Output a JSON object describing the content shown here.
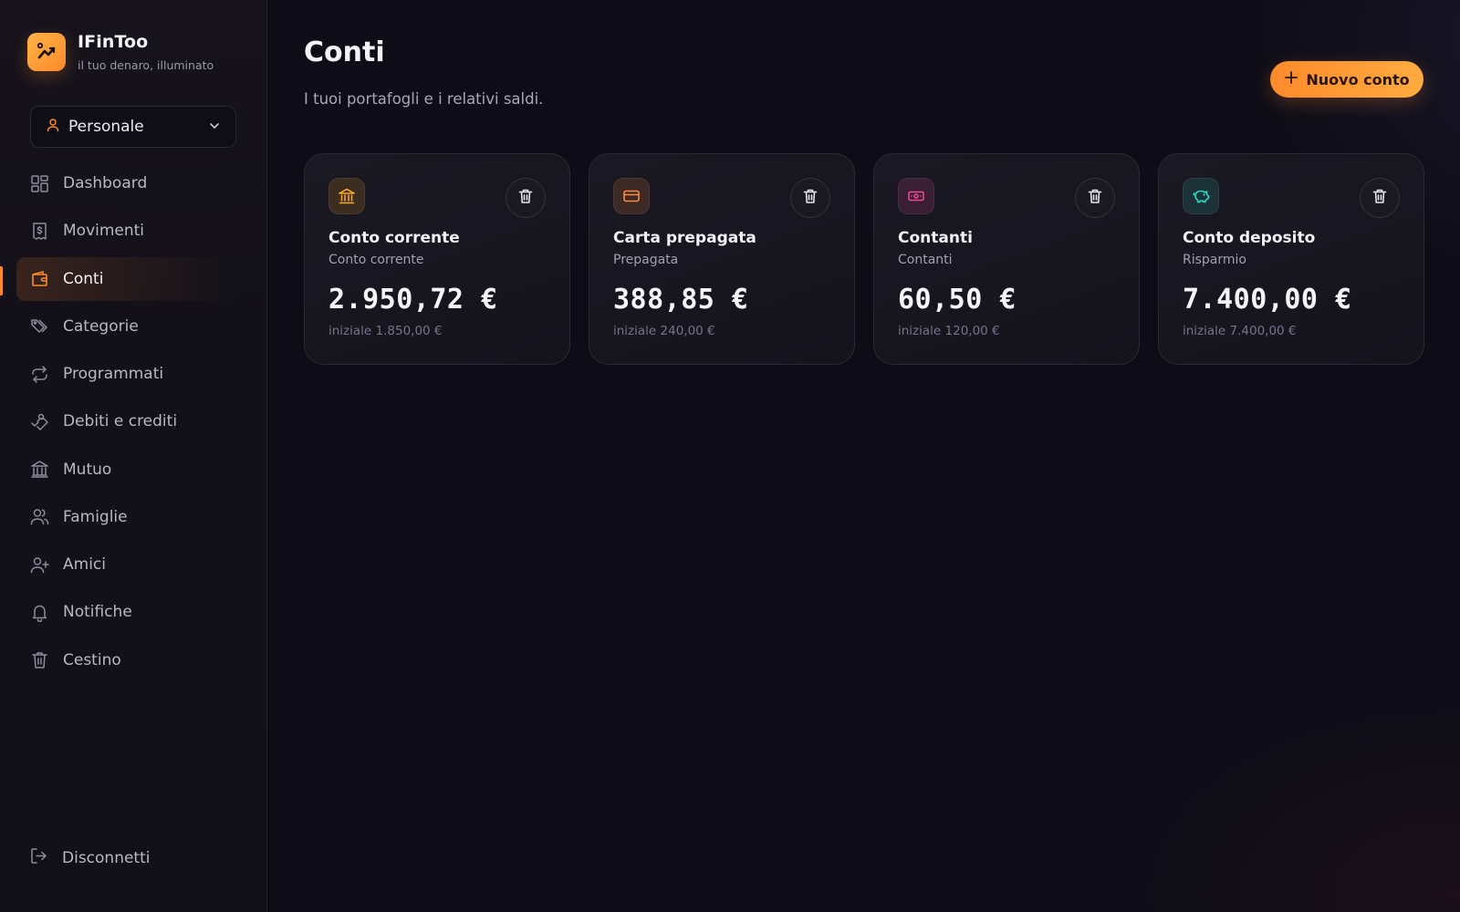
{
  "brand": {
    "name": "IFinToo",
    "tagline": "il tuo denaro, illuminato"
  },
  "profile": {
    "label": "Personale"
  },
  "nav": {
    "items": [
      {
        "label": "Dashboard",
        "icon": "dashboard-icon"
      },
      {
        "label": "Movimenti",
        "icon": "receipt-icon"
      },
      {
        "label": "Conti",
        "icon": "wallet-icon",
        "active": true
      },
      {
        "label": "Categorie",
        "icon": "tags-icon"
      },
      {
        "label": "Programmati",
        "icon": "repeat-icon"
      },
      {
        "label": "Debiti e crediti",
        "icon": "handshake-icon"
      },
      {
        "label": "Mutuo",
        "icon": "bank-icon"
      },
      {
        "label": "Famiglie",
        "icon": "users-icon"
      },
      {
        "label": "Amici",
        "icon": "user-plus-icon"
      },
      {
        "label": "Notifiche",
        "icon": "bell-icon"
      },
      {
        "label": "Cestino",
        "icon": "trash-icon"
      }
    ],
    "logout": "Disconnetti"
  },
  "main": {
    "title": "Conti",
    "subtitle": "I tuoi portafogli e i relativi saldi.",
    "new_button": "Nuovo conto"
  },
  "accounts": [
    {
      "name": "Conto corrente",
      "type": "Conto corrente",
      "balance": "2.950,72 €",
      "initial": "iniziale 1.850,00 €",
      "icon": "bank-icon",
      "color": "#f5a623"
    },
    {
      "name": "Carta prepagata",
      "type": "Prepagata",
      "balance": "388,85 €",
      "initial": "iniziale 240,00 €",
      "icon": "credit-card-icon",
      "color": "#ff8a3d"
    },
    {
      "name": "Contanti",
      "type": "Contanti",
      "balance": "60,50 €",
      "initial": "iniziale 120,00 €",
      "icon": "banknote-icon",
      "color": "#ec4899"
    },
    {
      "name": "Conto deposito",
      "type": "Risparmio",
      "balance": "7.400,00 €",
      "initial": "iniziale 7.400,00 €",
      "icon": "piggy-bank-icon",
      "color": "#2dd4bf"
    }
  ],
  "colors": {
    "accent": "#ff8a2b",
    "background": "#0e0d17",
    "sidebar": "#131119"
  }
}
